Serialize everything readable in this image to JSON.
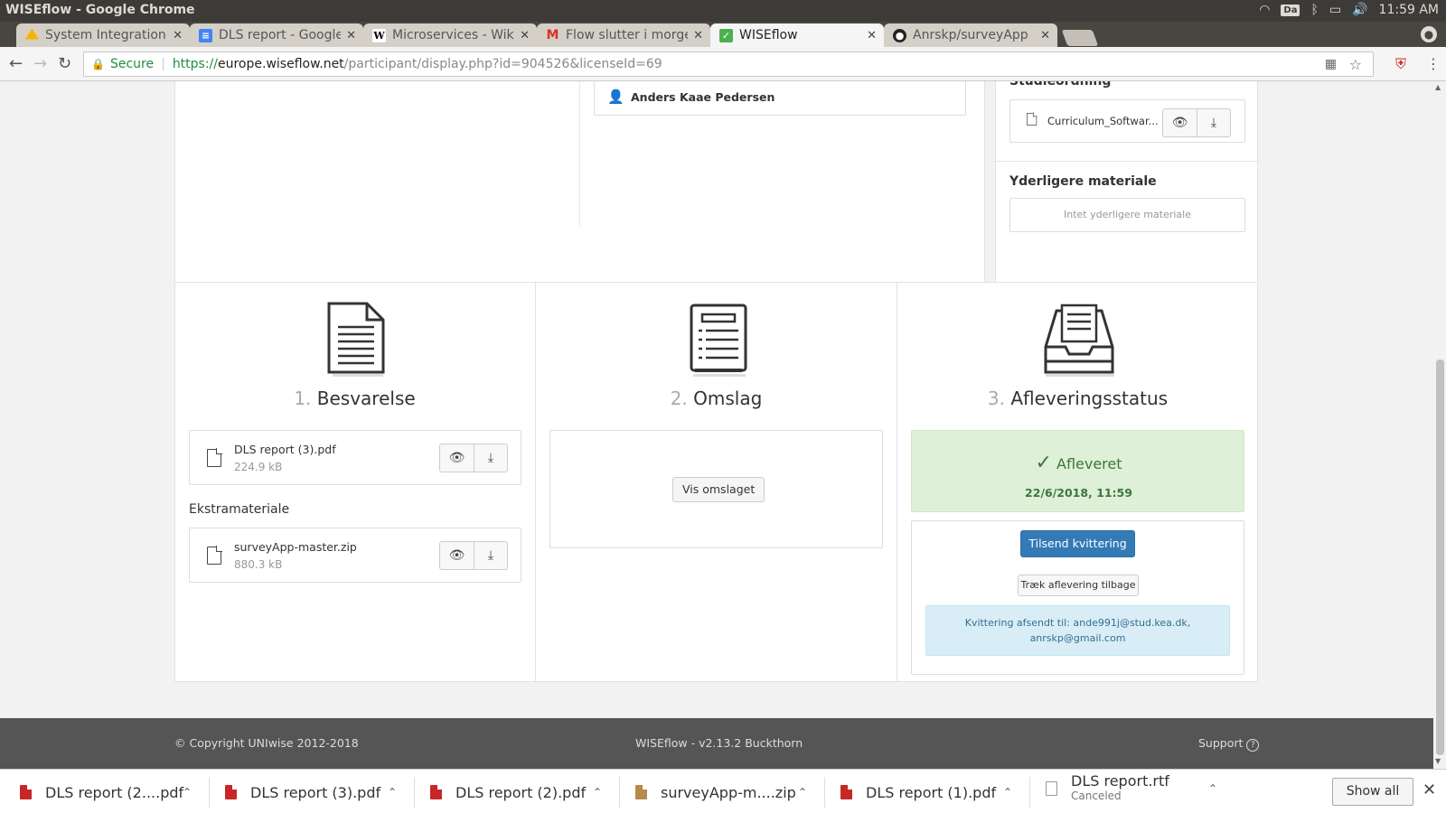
{
  "window": {
    "title": "WISEflow - Google Chrome",
    "keyboard_layout": "Da",
    "clock": "11:59 AM"
  },
  "tabs": [
    {
      "label": "System Integration",
      "icon": "drive-icon",
      "color": "#f4b400"
    },
    {
      "label": "DLS report - Google",
      "icon": "docs-icon",
      "color": "#4285f4"
    },
    {
      "label": "Microservices - Wiki",
      "icon": "wikipedia-icon",
      "color": "#ffffff"
    },
    {
      "label": "Flow slutter i morge",
      "icon": "gmail-icon",
      "color": "#d93025"
    },
    {
      "label": "WISEflow",
      "icon": "wiseflow-icon",
      "color": "#4caf50"
    },
    {
      "label": "Anrskp/surveyApp",
      "icon": "github-icon",
      "color": "#222222"
    }
  ],
  "address": {
    "secure_label": "Secure",
    "scheme": "https://",
    "host": "europe.wiseflow.net",
    "path": "/participant/display.php?id=904526&licenseId=69"
  },
  "top_section": {
    "person_name": "Anders Kaae Pedersen",
    "studieordning_label": "Studieordning",
    "curriculum_file": "Curriculum_Softwar...",
    "extra_material_heading": "Yderligere materiale",
    "extra_material_empty": "Intet yderligere materiale"
  },
  "steps": {
    "step1": {
      "number": "1.",
      "title": "Besvarelse"
    },
    "step2": {
      "number": "2.",
      "title": "Omslag"
    },
    "step3": {
      "number": "3.",
      "title": "Afleveringsstatus"
    }
  },
  "submission": {
    "main_file": {
      "name": "DLS report (3).pdf",
      "size": "224.9 kB"
    },
    "extra_heading": "Ekstramateriale",
    "extra_file": {
      "name": "surveyApp-master.zip",
      "size": "880.3 kB"
    }
  },
  "cover": {
    "show_button": "Vis omslaget"
  },
  "status": {
    "label": "Afleveret",
    "datetime": "22/6/2018, 11:59",
    "send_receipt_button": "Tilsend kvittering",
    "withdraw_button": "Træk aflevering tilbage",
    "receipt_info_line1": "Kvittering afsendt til: ande991j@stud.kea.dk,",
    "receipt_info_line2": "anrskp@gmail.com",
    "success_color": "#3c763d",
    "success_bg": "#dff0d8",
    "info_bg": "#d9edf7",
    "primary_color": "#337ab7"
  },
  "footer": {
    "copyright": "© Copyright UNIwise 2012-2018",
    "version": "WISEflow - v2.13.2 Buckthorn",
    "support": "Support"
  },
  "downloads": {
    "items": [
      {
        "name": "DLS report (2....pdf",
        "status": ""
      },
      {
        "name": "DLS report (3).pdf",
        "status": ""
      },
      {
        "name": "DLS report (2).pdf",
        "status": ""
      },
      {
        "name": "surveyApp-m....zip",
        "status": ""
      },
      {
        "name": "DLS report (1).pdf",
        "status": ""
      },
      {
        "name": "DLS report.rtf",
        "status": "Canceled"
      }
    ],
    "show_all": "Show all"
  }
}
